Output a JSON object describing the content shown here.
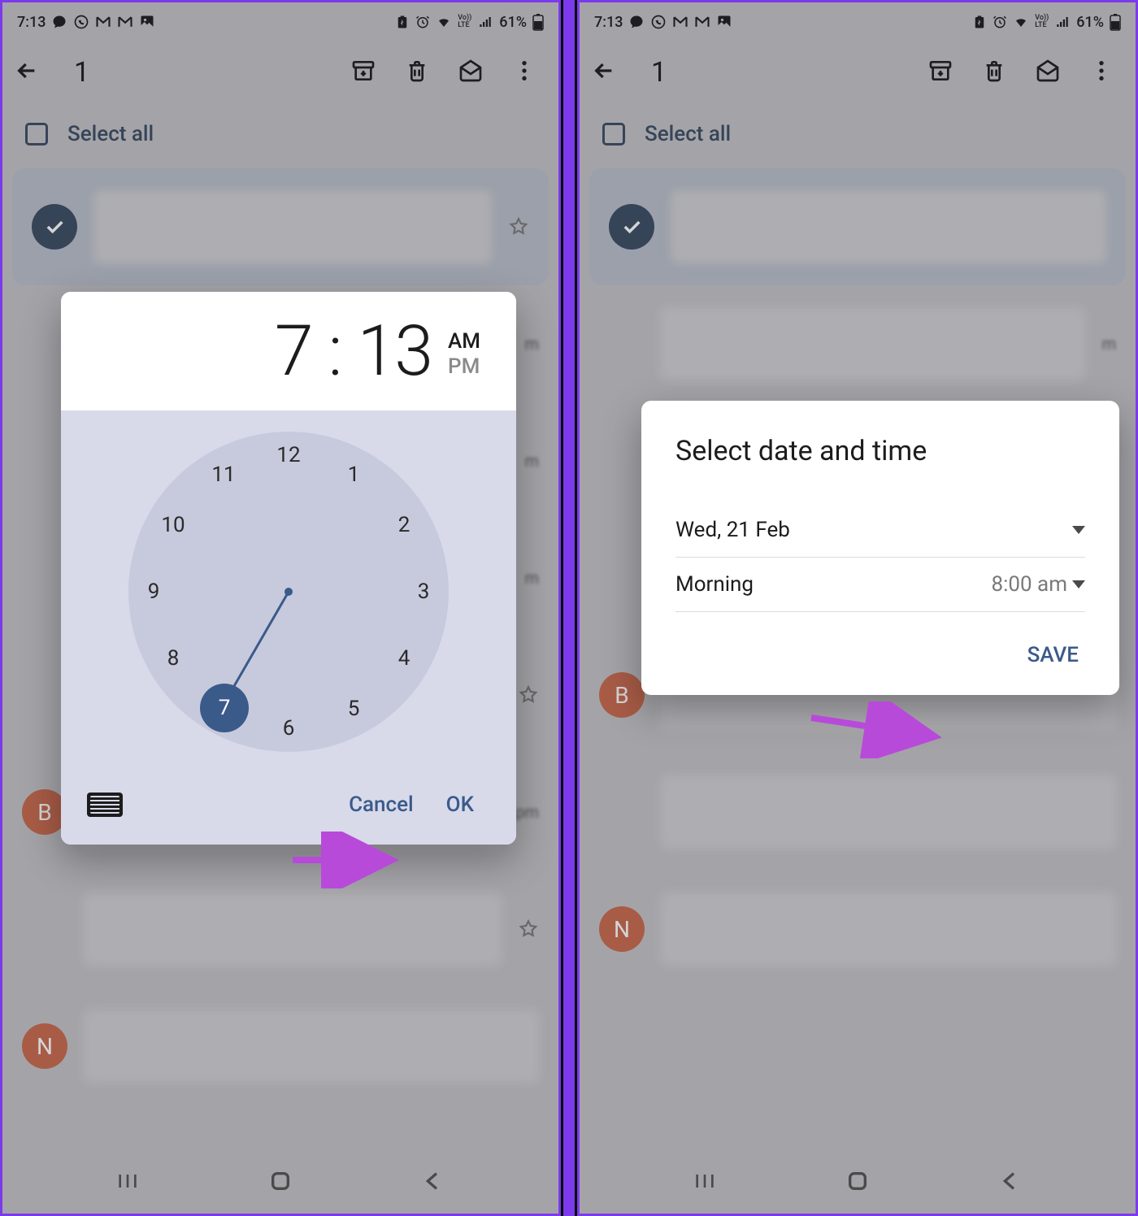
{
  "status": {
    "time": "7:13",
    "battery_text": "61%"
  },
  "appbar": {
    "selected_count": "1"
  },
  "select_all": {
    "label": "Select all"
  },
  "avatars": {
    "b_letter": "B",
    "n_letter": "N"
  },
  "row_times": {
    "m1": "m",
    "m2": "m",
    "m3": "m",
    "pm": "pm"
  },
  "time_picker": {
    "hours": "7",
    "minutes": "13",
    "am_label": "AM",
    "pm_label": "PM",
    "cancel": "Cancel",
    "ok": "OK",
    "numbers": {
      "n1": "1",
      "n2": "2",
      "n3": "3",
      "n4": "4",
      "n5": "5",
      "n6": "6",
      "n7": "7",
      "n8": "8",
      "n9": "9",
      "n10": "10",
      "n11": "11",
      "n12": "12"
    }
  },
  "datetime_picker": {
    "title": "Select date and time",
    "date_label": "Wed, 21 Feb",
    "preset_label": "Morning",
    "preset_time": "8:00 am",
    "save": "SAVE"
  }
}
